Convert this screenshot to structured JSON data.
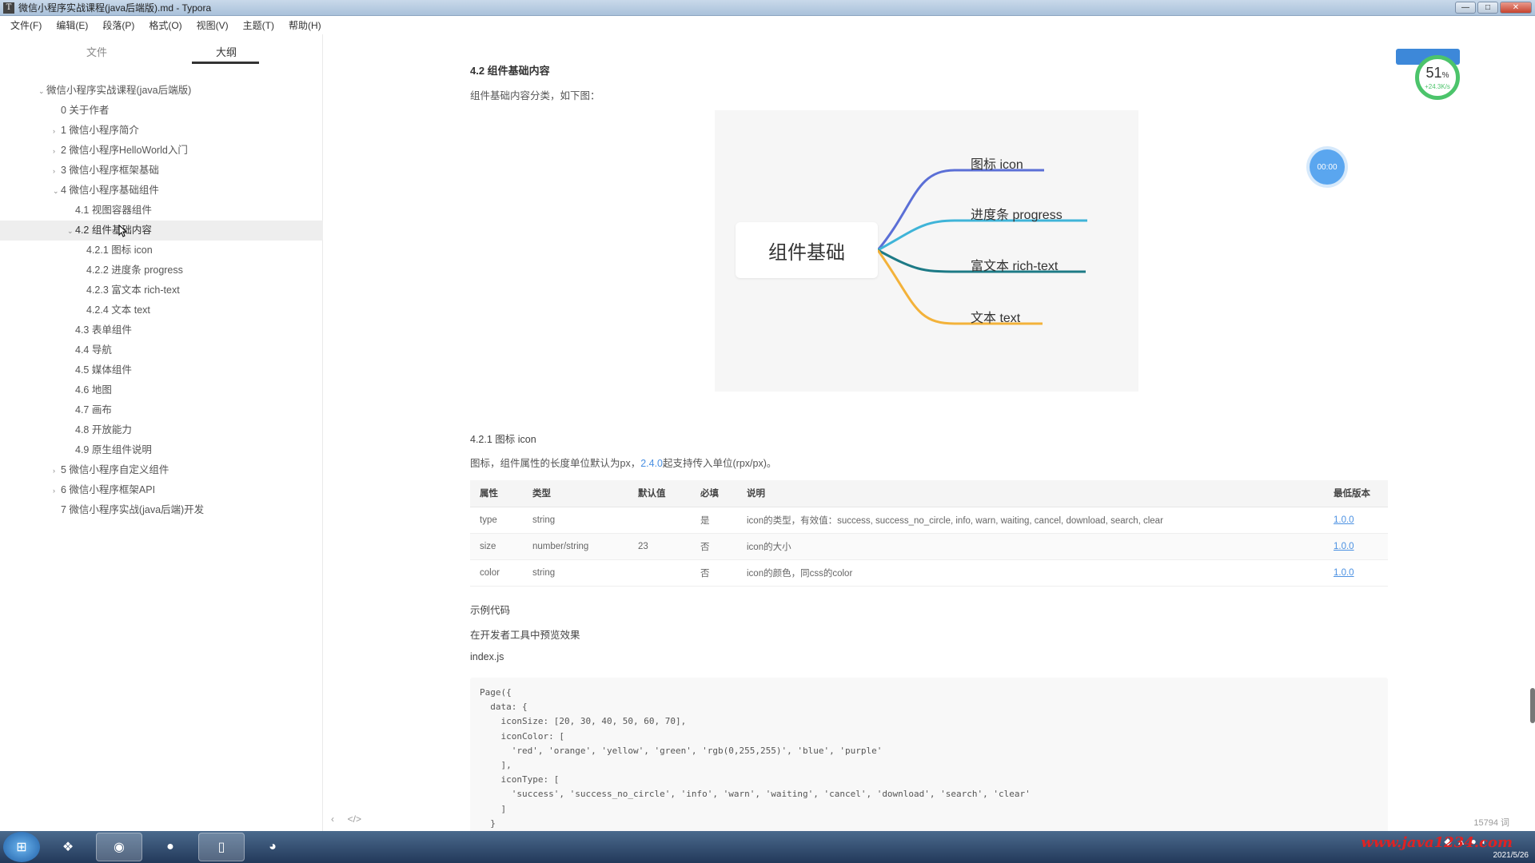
{
  "window": {
    "title": "微信小程序实战课程(java后端版).md - Typora",
    "buttons": [
      "—",
      "□",
      "✕"
    ]
  },
  "menu": [
    "文件(F)",
    "编辑(E)",
    "段落(P)",
    "格式(O)",
    "视图(V)",
    "主题(T)",
    "帮助(H)"
  ],
  "sidebar": {
    "tab_files": "文件",
    "tab_outline": "大纲",
    "outline": [
      {
        "label": "微信小程序实战课程(java后端版)",
        "level": 0,
        "caret": "⌄"
      },
      {
        "label": "0 关于作者",
        "level": 1,
        "caret": ""
      },
      {
        "label": "1 微信小程序简介",
        "level": 1,
        "caret": "›"
      },
      {
        "label": "2 微信小程序HelloWorld入门",
        "level": 1,
        "caret": "›"
      },
      {
        "label": "3 微信小程序框架基础",
        "level": 1,
        "caret": "›"
      },
      {
        "label": "4 微信小程序基础组件",
        "level": 1,
        "caret": "⌄"
      },
      {
        "label": "4.1 视图容器组件",
        "level": 2,
        "caret": ""
      },
      {
        "label": "4.2 组件基础内容",
        "level": 2,
        "caret": "⌄",
        "active": true
      },
      {
        "label": "4.2.1 图标 icon",
        "level": 3,
        "caret": ""
      },
      {
        "label": "4.2.2 进度条 progress",
        "level": 3,
        "caret": ""
      },
      {
        "label": "4.2.3 富文本 rich-text",
        "level": 3,
        "caret": ""
      },
      {
        "label": "4.2.4 文本 text",
        "level": 3,
        "caret": ""
      },
      {
        "label": "4.3 表单组件",
        "level": 2,
        "caret": ""
      },
      {
        "label": "4.4 导航",
        "level": 2,
        "caret": ""
      },
      {
        "label": "4.5 媒体组件",
        "level": 2,
        "caret": ""
      },
      {
        "label": "4.6 地图",
        "level": 2,
        "caret": ""
      },
      {
        "label": "4.7 画布",
        "level": 2,
        "caret": ""
      },
      {
        "label": "4.8 开放能力",
        "level": 2,
        "caret": ""
      },
      {
        "label": "4.9 原生组件说明",
        "level": 2,
        "caret": ""
      },
      {
        "label": "5 微信小程序自定义组件",
        "level": 1,
        "caret": "›"
      },
      {
        "label": "6 微信小程序框架API",
        "level": 1,
        "caret": "›"
      },
      {
        "label": "7 微信小程序实战(java后端)开发",
        "level": 1,
        "caret": ""
      }
    ]
  },
  "content": {
    "heading_42": "4.2 组件基础内容",
    "intro": "组件基础内容分类，如下图：",
    "mindmap": {
      "root": "组件基础",
      "branches": [
        {
          "label": "图标 icon",
          "color": "#5b6fd6"
        },
        {
          "label": "进度条 progress",
          "color": "#3fb4d8"
        },
        {
          "label": "富文本 rich-text",
          "color": "#1d7a86"
        },
        {
          "label": "文本 text",
          "color": "#f3b23a"
        }
      ]
    },
    "heading_421": "4.2.1 图标 icon",
    "icon_desc_prefix": "图标，组件属性的长度单位默认为px，",
    "icon_desc_link": "2.4.0",
    "icon_desc_suffix": "起支持传入单位(rpx/px)。",
    "table": {
      "headers": [
        "属性",
        "类型",
        "默认值",
        "必填",
        "说明",
        "最低版本"
      ],
      "rows": [
        [
          "type",
          "string",
          "",
          "是",
          "icon的类型，有效值：success, success_no_circle, info, warn, waiting, cancel, download, search, clear",
          "1.0.0"
        ],
        [
          "size",
          "number/string",
          "23",
          "否",
          "icon的大小",
          "1.0.0"
        ],
        [
          "color",
          "string",
          "",
          "否",
          "icon的颜色，同css的color",
          "1.0.0"
        ]
      ]
    },
    "example_title": "示例代码",
    "example_link": "在开发者工具中预览效果",
    "file_name": "index.js",
    "code_lines": [
      "Page({",
      "  data: {",
      "    iconSize: [20, 30, 40, 50, 60, 70],",
      "    iconColor: [",
      "      'red', 'orange', 'yellow', 'green', 'rgb(0,255,255)', 'blue', 'purple'",
      "    ],",
      "    iconType: [",
      "      'success', 'success_no_circle', 'info', 'warn', 'waiting', 'cancel', 'download', 'search', 'clear'",
      "    ]",
      "  }"
    ]
  },
  "widgets": {
    "float_dot": "00:00",
    "meter_pct": "51",
    "meter_unit": "%",
    "meter_sub": "+24.3K/s",
    "word_count": "15794 词",
    "foot_left": "‹",
    "foot_code": "</>"
  },
  "taskbar": {
    "watermark": "www.java1234.com",
    "time": "12:43",
    "date": "2021/5/26"
  }
}
